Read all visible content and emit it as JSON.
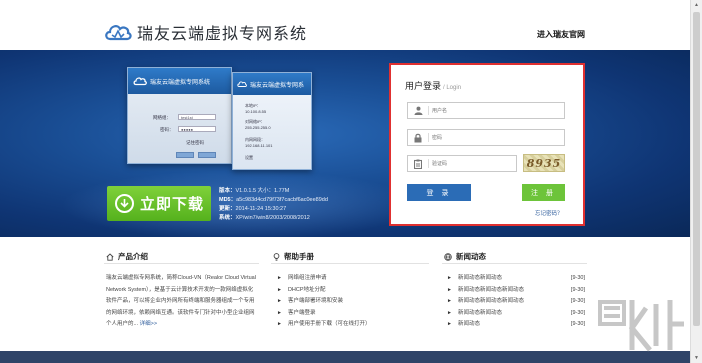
{
  "header": {
    "logo_text": "瑞友云端虚拟专网系统",
    "enter_link": "进入瑞友官网"
  },
  "banner": {
    "card": {
      "title": "瑞友云端虚拟专网系统",
      "row1_label": "网络组：",
      "row1_value": "test1st",
      "row2_label": "密码：",
      "row2_value": "●●●●●",
      "remember": "记住密码"
    },
    "card2": {
      "title": "瑞友云端虚拟专网系",
      "items": [
        "本地IP：",
        "10.100.8.55",
        "对网络IP：",
        "255.255.255.0",
        "内网网段：",
        "192.168.11.101",
        "设置"
      ]
    },
    "download_label": "立即下载",
    "info": {
      "version_label": "版本：",
      "version_value": "V1.0.1.5 大小：1.77M",
      "md5_label": "MD5：",
      "md5_value": "a5c983d4cd79f73f7cacbf6ac0ee89dd",
      "date_label": "更新：",
      "date_value": "2014-11-24 15:30:27",
      "system_label": "系统：",
      "system_value": "XP/win7/win8/2003/2008/2012"
    }
  },
  "login": {
    "title": "用户登录",
    "subtitle": "/ Login",
    "username_placeholder": "用户名",
    "password_placeholder": "密码",
    "captcha_placeholder": "验证码",
    "captcha_code": "8935",
    "login_button": "登 录",
    "register_button": "注 册",
    "forgot": "忘记密码？"
  },
  "sections": {
    "product": {
      "title": "产品介绍",
      "text": "瑞友云端虚拟专网系统，简称Cloud-VN（Realor Cloud Virtual Network System），是基于云计算技术开发的一款网络虚拟化软件产品，可以将企业内外网所有终端和服务器组成一个专用的网络环境，依赖网络互通。该软件专门针对中小型企业组网个人用户的...",
      "more": "详细>>"
    },
    "help": {
      "title": "帮助手册",
      "items": [
        "网络组注册申请",
        "DHCP地址分配",
        "客户端部署环境和安装",
        "客户端登录",
        "用户使用手册下载（可在线打开）"
      ]
    },
    "news": {
      "title": "新闻动态",
      "items": [
        {
          "title": "新闻动态新闻动态",
          "date": "[9-30]"
        },
        {
          "title": "新闻动态新闻动态新闻动态",
          "date": "[9-30]"
        },
        {
          "title": "新闻动态新闻动态新闻动态",
          "date": "[9-30]"
        },
        {
          "title": "新闻动态新闻动态",
          "date": "[9-30]"
        },
        {
          "title": "新闻动态",
          "date": "[9-30]"
        }
      ]
    }
  },
  "colors": {
    "banner_dark": "#0f3574",
    "login_border": "#e03030",
    "login_button": "#2b6cb6",
    "register_button": "#6dc43a",
    "download_green": "#55b11d"
  }
}
